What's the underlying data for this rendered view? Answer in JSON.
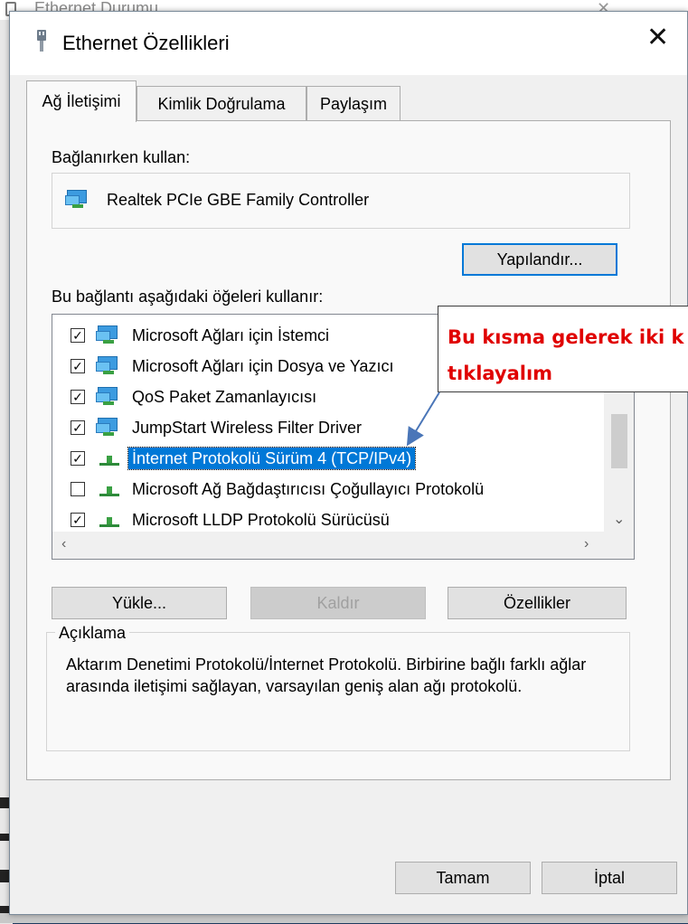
{
  "background_window": {
    "title": "Ethernet Durumu"
  },
  "dialog": {
    "title": "Ethernet Özellikleri",
    "tabs": [
      "Ağ İletişimi",
      "Kimlik Doğrulama",
      "Paylaşım"
    ],
    "connect_using_label": "Bağlanırken kullan:",
    "adapter_name": "Realtek PCIe GBE Family Controller",
    "configure_button": "Yapılandır...",
    "items_label": "Bu bağlantı aşağıdaki öğeleri kullanır:",
    "items": [
      {
        "label": "Microsoft Ağları için İstemci",
        "checked": true,
        "icon": "network-client-icon"
      },
      {
        "label": "Microsoft Ağları için Dosya ve Yazıcı",
        "checked": true,
        "icon": "network-service-icon"
      },
      {
        "label": "QoS Paket Zamanlayıcısı",
        "checked": true,
        "icon": "network-service-icon"
      },
      {
        "label": "JumpStart Wireless Filter Driver",
        "checked": true,
        "icon": "network-service-icon"
      },
      {
        "label": "İnternet Protokolü Sürüm 4 (TCP/IPv4)",
        "checked": true,
        "icon": "protocol-icon",
        "selected": true
      },
      {
        "label": "Microsoft Ağ Bağdaştırıcısı Çoğullayıcı Protokolü",
        "checked": false,
        "icon": "protocol-icon"
      },
      {
        "label": "Microsoft LLDP Protokolü Sürücüsü",
        "checked": true,
        "icon": "protocol-icon"
      }
    ],
    "install_button": "Yükle...",
    "uninstall_button": "Kaldır",
    "properties_button": "Özellikler",
    "description_legend": "Açıklama",
    "description_text": "Aktarım Denetimi Protokolü/İnternet Protokolü. Birbirine bağlı farklı ağlar arasında iletişimi sağlayan, varsayılan geniş alan ağı protokolü.",
    "ok_button": "Tamam",
    "cancel_button": "İptal"
  },
  "annotation": {
    "line1": "Bu kısma gelerek iki k",
    "line2": "tıklayalım",
    "color": "#e00000"
  },
  "colors": {
    "selection": "#0078d7",
    "accent": "#0078d7"
  }
}
